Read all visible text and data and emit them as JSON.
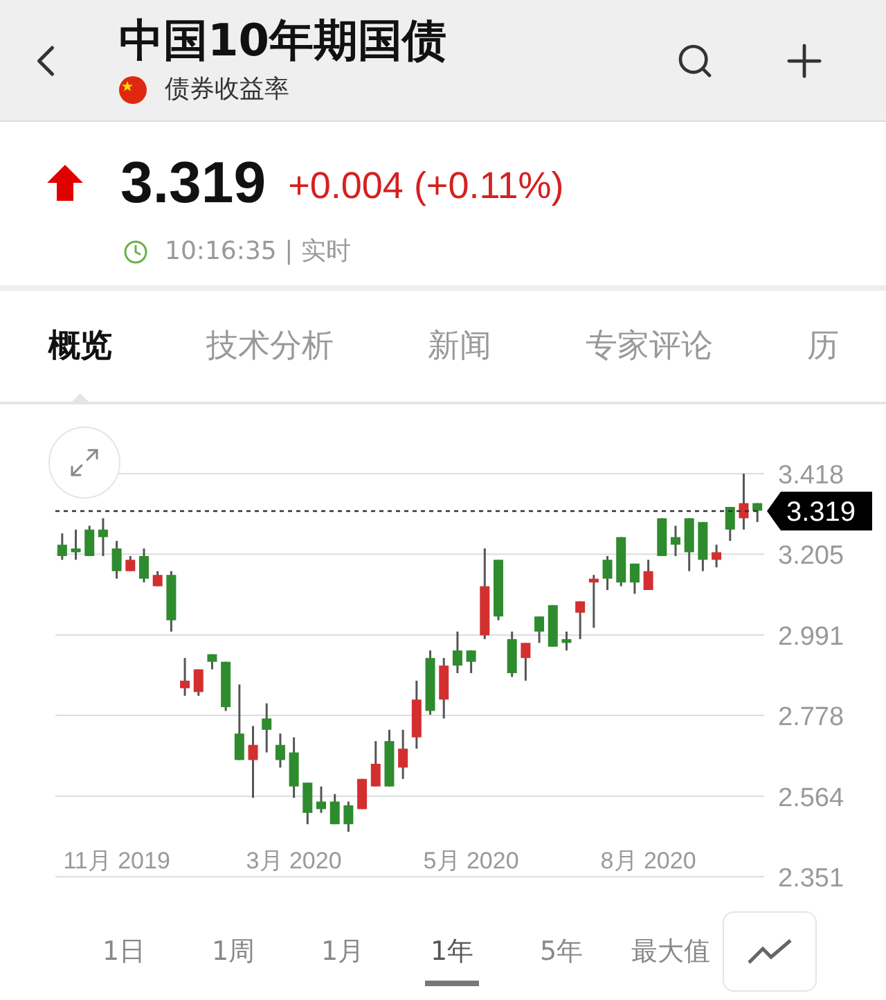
{
  "header": {
    "title": "中国10年期国债",
    "subtitle": "债券收益率"
  },
  "quote": {
    "rising": true,
    "price": "3.319",
    "change": "+0.004 (+0.11%)",
    "time": "10:16:35 | 实时"
  },
  "tabs": [
    {
      "label": "概览",
      "selected": true
    },
    {
      "label": "技术分析",
      "selected": false
    },
    {
      "label": "新闻",
      "selected": false
    },
    {
      "label": "专家评论",
      "selected": false
    },
    {
      "label": "历",
      "selected": false
    }
  ],
  "chart": {
    "chart_data": {
      "type": "candlestick",
      "ylim": [
        2.351,
        3.418
      ],
      "grid": true,
      "ref_lines": [
        {
          "axis": "y",
          "value": 3.319,
          "label": "3.319"
        }
      ],
      "yticks": [
        3.418,
        3.205,
        2.991,
        2.778,
        2.564,
        2.351
      ],
      "categories": [
        null,
        null,
        null,
        null,
        "11月 2019",
        null,
        null,
        null,
        null,
        null,
        null,
        null,
        null,
        null,
        null,
        null,
        null,
        "3月 2020",
        null,
        null,
        null,
        null,
        null,
        null,
        null,
        null,
        null,
        null,
        null,
        null,
        "5月 2020",
        null,
        null,
        null,
        null,
        null,
        null,
        null,
        null,
        null,
        null,
        null,
        null,
        "8月 2020",
        null,
        null,
        null,
        null,
        null,
        null,
        null,
        null
      ],
      "ohlc": [
        [
          3.23,
          3.26,
          3.19,
          3.2
        ],
        [
          3.22,
          3.27,
          3.19,
          3.21
        ],
        [
          3.27,
          3.28,
          3.2,
          3.2
        ],
        [
          3.27,
          3.3,
          3.2,
          3.25
        ],
        [
          3.22,
          3.24,
          3.14,
          3.16
        ],
        [
          3.16,
          3.2,
          3.16,
          3.19
        ],
        [
          3.2,
          3.22,
          3.13,
          3.14
        ],
        [
          3.12,
          3.16,
          3.12,
          3.15
        ],
        [
          3.15,
          3.16,
          3.0,
          3.03
        ],
        [
          2.85,
          2.93,
          2.83,
          2.87
        ],
        [
          2.84,
          2.9,
          2.83,
          2.9
        ],
        [
          2.94,
          2.94,
          2.9,
          2.92
        ],
        [
          2.92,
          2.92,
          2.79,
          2.8
        ],
        [
          2.73,
          2.86,
          2.66,
          2.66
        ],
        [
          2.66,
          2.75,
          2.56,
          2.7
        ],
        [
          2.77,
          2.81,
          2.68,
          2.74
        ],
        [
          2.7,
          2.73,
          2.64,
          2.66
        ],
        [
          2.68,
          2.72,
          2.56,
          2.59
        ],
        [
          2.6,
          2.6,
          2.49,
          2.52
        ],
        [
          2.55,
          2.59,
          2.52,
          2.53
        ],
        [
          2.55,
          2.57,
          2.49,
          2.49
        ],
        [
          2.54,
          2.55,
          2.47,
          2.49
        ],
        [
          2.53,
          2.61,
          2.53,
          2.61
        ],
        [
          2.59,
          2.71,
          2.59,
          2.65
        ],
        [
          2.71,
          2.74,
          2.59,
          2.59
        ],
        [
          2.64,
          2.74,
          2.61,
          2.69
        ],
        [
          2.72,
          2.87,
          2.69,
          2.82
        ],
        [
          2.93,
          2.95,
          2.78,
          2.79
        ],
        [
          2.82,
          2.93,
          2.77,
          2.91
        ],
        [
          2.95,
          3.0,
          2.89,
          2.91
        ],
        [
          2.95,
          2.95,
          2.89,
          2.92
        ],
        [
          2.99,
          3.22,
          2.98,
          3.12
        ],
        [
          3.19,
          3.19,
          3.03,
          3.04
        ],
        [
          2.98,
          3.0,
          2.88,
          2.89
        ],
        [
          2.93,
          2.97,
          2.87,
          2.97
        ],
        [
          3.04,
          3.04,
          2.97,
          3.0
        ],
        [
          3.07,
          3.07,
          2.96,
          2.96
        ],
        [
          2.98,
          3.0,
          2.95,
          2.97
        ],
        [
          3.05,
          3.08,
          2.98,
          3.08
        ],
        [
          3.13,
          3.15,
          3.01,
          3.14
        ],
        [
          3.19,
          3.2,
          3.11,
          3.14
        ],
        [
          3.25,
          3.25,
          3.12,
          3.13
        ],
        [
          3.18,
          3.18,
          3.1,
          3.13
        ],
        [
          3.11,
          3.19,
          3.11,
          3.16
        ],
        [
          3.3,
          3.3,
          3.2,
          3.2
        ],
        [
          3.25,
          3.28,
          3.2,
          3.23
        ],
        [
          3.3,
          3.3,
          3.16,
          3.21
        ],
        [
          3.29,
          3.29,
          3.16,
          3.19
        ],
        [
          3.19,
          3.23,
          3.17,
          3.21
        ],
        [
          3.33,
          3.33,
          3.24,
          3.27
        ],
        [
          3.3,
          3.418,
          3.27,
          3.34
        ],
        [
          3.34,
          3.34,
          3.29,
          3.32
        ]
      ]
    }
  },
  "ranges": [
    {
      "label": "1日",
      "selected": false
    },
    {
      "label": "1周",
      "selected": false
    },
    {
      "label": "1月",
      "selected": false
    },
    {
      "label": "1年",
      "selected": true
    },
    {
      "label": "5年",
      "selected": false
    },
    {
      "label": "最大值",
      "selected": false
    }
  ]
}
